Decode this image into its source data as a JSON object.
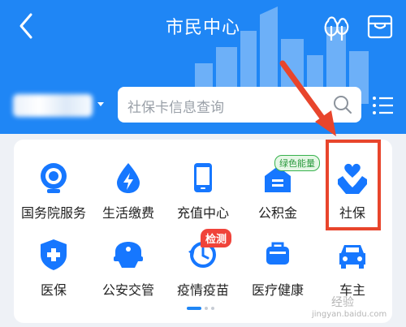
{
  "header": {
    "title": "市民中心",
    "background_color": "#1f86f5"
  },
  "search": {
    "placeholder": "社保卡信息查询"
  },
  "grid": {
    "items": [
      {
        "label": "国务院服务",
        "icon": "state-council-icon"
      },
      {
        "label": "生活缴费",
        "icon": "utility-payment-icon"
      },
      {
        "label": "充值中心",
        "icon": "phone-recharge-icon"
      },
      {
        "label": "公积金",
        "icon": "housing-fund-icon"
      },
      {
        "label": "社保",
        "icon": "social-security-icon"
      },
      {
        "label": "医保",
        "icon": "medical-insurance-icon"
      },
      {
        "label": "公安交管",
        "icon": "police-traffic-icon"
      },
      {
        "label": "疫情疫苗",
        "icon": "vaccine-icon"
      },
      {
        "label": "医疗健康",
        "icon": "medical-health-icon"
      },
      {
        "label": "车主",
        "icon": "car-owner-icon"
      }
    ],
    "badges": {
      "housing_fund": "绿色能量",
      "vaccine": "检测"
    }
  },
  "annotation": {
    "color": "#e8452c"
  },
  "watermark": {
    "text": "经验",
    "url": "jingyan.baidu.com"
  }
}
